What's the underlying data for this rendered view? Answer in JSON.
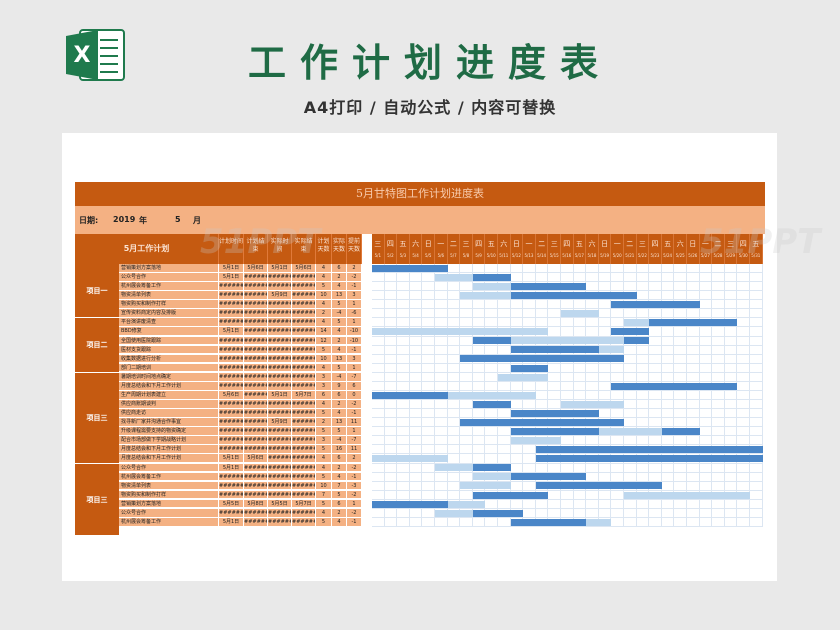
{
  "header": {
    "title": "工作计划进度表",
    "subtitle": "A4打印 / 自动公式 / 内容可替换",
    "logo_icon": "excel-icon",
    "logo_letter": "X"
  },
  "sheet": {
    "banner_title": "5月甘特图工作计划进度表",
    "date_label": "日期:",
    "year": "2019",
    "year_unit": "年",
    "month": "5",
    "month_unit": "月",
    "task_header": "5月工作计划",
    "col_headers": [
      "计划时间",
      "计划结束",
      "实际时间",
      "实际结束",
      "计划天数",
      "实际天数",
      "提前天数"
    ],
    "weekdays": [
      "三",
      "四",
      "五",
      "六",
      "日",
      "一",
      "二",
      "三",
      "四",
      "五",
      "六",
      "日",
      "一",
      "二",
      "三",
      "四",
      "五",
      "六",
      "日",
      "一",
      "二",
      "三",
      "四",
      "五",
      "六",
      "日",
      "一",
      "二",
      "三",
      "四",
      "五"
    ],
    "dates": [
      "5/1",
      "5/2",
      "5/3",
      "5/4",
      "5/5",
      "5/6",
      "5/7",
      "5/8",
      "5/9",
      "5/10",
      "5/11",
      "5/12",
      "5/13",
      "5/14",
      "5/15",
      "5/16",
      "5/17",
      "5/18",
      "5/19",
      "5/20",
      "5/21",
      "5/22",
      "5/23",
      "5/24",
      "5/25",
      "5/26",
      "5/27",
      "5/28",
      "5/29",
      "5/30",
      "5/31"
    ],
    "groups": [
      {
        "label": "项目一",
        "start": 0,
        "count": 6
      },
      {
        "label": "项目二",
        "start": 6,
        "count": 6
      },
      {
        "label": "项目三",
        "start": 12,
        "count": 10
      },
      {
        "label": "项目三",
        "start": 22,
        "count": 8
      }
    ],
    "tasks": [
      {
        "name": "营销策划方案落地",
        "c": [
          "5月1日",
          "5月6日",
          "5月1日",
          "5月6日",
          "4",
          "6",
          "2"
        ],
        "bars": [
          [
            0,
            6,
            "dark"
          ]
        ]
      },
      {
        "name": "公众号合作",
        "c": [
          "5月1日",
          "######",
          "######",
          "######",
          "4",
          "2",
          "-2"
        ],
        "bars": [
          [
            5,
            3,
            "light"
          ],
          [
            8,
            3,
            "dark"
          ]
        ]
      },
      {
        "name": "杭州展会筹备工作",
        "c": [
          "######",
          "######",
          "######",
          "######",
          "5",
          "4",
          "-1"
        ],
        "bars": [
          [
            8,
            3,
            "light"
          ],
          [
            11,
            6,
            "dark"
          ]
        ]
      },
      {
        "name": "物资清单列表",
        "c": [
          "######",
          "######",
          "5月9日",
          "######",
          "10",
          "13",
          "3"
        ],
        "bars": [
          [
            7,
            4,
            "light"
          ],
          [
            11,
            10,
            "dark"
          ]
        ]
      },
      {
        "name": "物资购买和制作打样",
        "c": [
          "######",
          "######",
          "######",
          "######",
          "4",
          "5",
          "1"
        ],
        "bars": [
          [
            19,
            7,
            "dark"
          ]
        ]
      },
      {
        "name": "宣传资料商定内容及排版",
        "c": [
          "######",
          "######",
          "######",
          "######",
          "2",
          "-4",
          "-6"
        ],
        "bars": [
          [
            15,
            3,
            "light"
          ]
        ]
      },
      {
        "name": "平台演讲废清查",
        "c": [
          "######",
          "######",
          "######",
          "######",
          "4",
          "5",
          "1"
        ],
        "bars": [
          [
            20,
            2,
            "light"
          ],
          [
            22,
            7,
            "dark"
          ]
        ]
      },
      {
        "name": "BBD修复",
        "c": [
          "5月1日",
          "######",
          "######",
          "######",
          "14",
          "4",
          "-10"
        ],
        "bars": [
          [
            0,
            14,
            "light"
          ],
          [
            19,
            3,
            "dark"
          ]
        ]
      },
      {
        "name": "全国使用医院跟踪",
        "c": [
          "######",
          "######",
          "######",
          "######",
          "12",
          "2",
          "-10"
        ],
        "bars": [
          [
            8,
            3,
            "dark"
          ],
          [
            11,
            9,
            "light"
          ],
          [
            20,
            2,
            "dark"
          ]
        ]
      },
      {
        "name": "医材支货跟踪",
        "c": [
          "######",
          "######",
          "######",
          "######",
          "5",
          "4",
          "-1"
        ],
        "bars": [
          [
            11,
            7,
            "dark"
          ],
          [
            18,
            2,
            "light"
          ]
        ]
      },
      {
        "name": "收集数据进行分析",
        "c": [
          "######",
          "######",
          "######",
          "######",
          "10",
          "13",
          "3"
        ],
        "bars": [
          [
            7,
            13,
            "dark"
          ]
        ]
      },
      {
        "name": "部门二期培训",
        "c": [
          "######",
          "######",
          "######",
          "######",
          "4",
          "5",
          "1"
        ],
        "bars": [
          [
            11,
            3,
            "dark"
          ]
        ]
      },
      {
        "name": "暑期培训时间地点确定",
        "c": [
          "######",
          "######",
          "######",
          "######",
          "3",
          "-4",
          "-7"
        ],
        "bars": [
          [
            10,
            4,
            "light"
          ]
        ]
      },
      {
        "name": "月度总结会和下月工作计划",
        "c": [
          "######",
          "######",
          "######",
          "######",
          "3",
          "9",
          "6"
        ],
        "bars": [
          [
            19,
            10,
            "dark"
          ]
        ]
      },
      {
        "name": "生产周期计划表建立",
        "c": [
          "5月6日",
          "######",
          "5月1日",
          "5月7日",
          "6",
          "6",
          "0"
        ],
        "bars": [
          [
            0,
            6,
            "dark"
          ],
          [
            6,
            7,
            "light"
          ]
        ]
      },
      {
        "name": "供应商账期谈判",
        "c": [
          "######",
          "######",
          "######",
          "######",
          "4",
          "2",
          "-2"
        ],
        "bars": [
          [
            8,
            3,
            "dark"
          ],
          [
            15,
            5,
            "light"
          ]
        ]
      },
      {
        "name": "供应商走访",
        "c": [
          "######",
          "######",
          "######",
          "######",
          "5",
          "4",
          "-1"
        ],
        "bars": [
          [
            11,
            7,
            "dark"
          ]
        ]
      },
      {
        "name": "找寻新厂家并沟通合作事宜",
        "c": [
          "######",
          "######",
          "5月9日",
          "######",
          "2",
          "13",
          "11"
        ],
        "bars": [
          [
            7,
            13,
            "dark"
          ]
        ]
      },
      {
        "name": "升级课程需要支持的物资确定",
        "c": [
          "######",
          "######",
          "######",
          "######",
          "5",
          "5",
          "1"
        ],
        "bars": [
          [
            11,
            7,
            "dark"
          ],
          [
            18,
            5,
            "light"
          ],
          [
            23,
            3,
            "dark"
          ]
        ]
      },
      {
        "name": "配合市场部做下学期战略计划",
        "c": [
          "######",
          "######",
          "######",
          "######",
          "3",
          "-4",
          "-7"
        ],
        "bars": [
          [
            11,
            4,
            "light"
          ]
        ]
      },
      {
        "name": "月度总结会和下月工作计划",
        "c": [
          "######",
          "######",
          "######",
          "######",
          "5",
          "16",
          "11"
        ],
        "bars": [
          [
            13,
            18,
            "dark"
          ]
        ]
      },
      {
        "name": "月度总结会和下月工作计划",
        "c": [
          "5月1日",
          "5月6日",
          "######",
          "######",
          "4",
          "6",
          "2"
        ],
        "bars": [
          [
            0,
            6,
            "light"
          ],
          [
            13,
            18,
            "dark"
          ]
        ]
      },
      {
        "name": "公众号合作",
        "c": [
          "5月1日",
          "######",
          "######",
          "######",
          "4",
          "2",
          "-2"
        ],
        "bars": [
          [
            5,
            3,
            "light"
          ],
          [
            8,
            3,
            "dark"
          ]
        ]
      },
      {
        "name": "杭州展会筹备工作",
        "c": [
          "######",
          "######",
          "######",
          "######",
          "5",
          "4",
          "-1"
        ],
        "bars": [
          [
            8,
            3,
            "light"
          ],
          [
            11,
            6,
            "dark"
          ]
        ]
      },
      {
        "name": "物资清单列表",
        "c": [
          "######",
          "######",
          "######",
          "######",
          "10",
          "7",
          "-3"
        ],
        "bars": [
          [
            7,
            4,
            "light"
          ],
          [
            13,
            10,
            "dark"
          ]
        ]
      },
      {
        "name": "物资购买和制作打样",
        "c": [
          "######",
          "######",
          "######",
          "######",
          "7",
          "5",
          "-2"
        ],
        "bars": [
          [
            8,
            6,
            "dark"
          ],
          [
            20,
            10,
            "light"
          ]
        ]
      },
      {
        "name": "营销策划方案落地",
        "c": [
          "5月5日",
          "5月8日",
          "5月5日",
          "5月7日",
          "5",
          "6",
          "1"
        ],
        "bars": [
          [
            0,
            6,
            "dark"
          ],
          [
            6,
            3,
            "light"
          ]
        ]
      },
      {
        "name": "公众号合作",
        "c": [
          "######",
          "######",
          "######",
          "######",
          "4",
          "2",
          "-2"
        ],
        "bars": [
          [
            5,
            3,
            "light"
          ],
          [
            8,
            4,
            "dark"
          ]
        ]
      },
      {
        "name": "杭州展会筹备工作",
        "c": [
          "5月1日",
          "######",
          "######",
          "######",
          "5",
          "4",
          "-1"
        ],
        "bars": [
          [
            11,
            6,
            "dark"
          ],
          [
            17,
            2,
            "light"
          ]
        ]
      }
    ]
  },
  "colors": {
    "brand_green": "#1f6b45",
    "orange_dark": "#c55a11",
    "orange_light": "#f4b183",
    "bar_dark": "#4a86c8",
    "bar_light": "#bdd7ee"
  },
  "watermark": "51PPT"
}
